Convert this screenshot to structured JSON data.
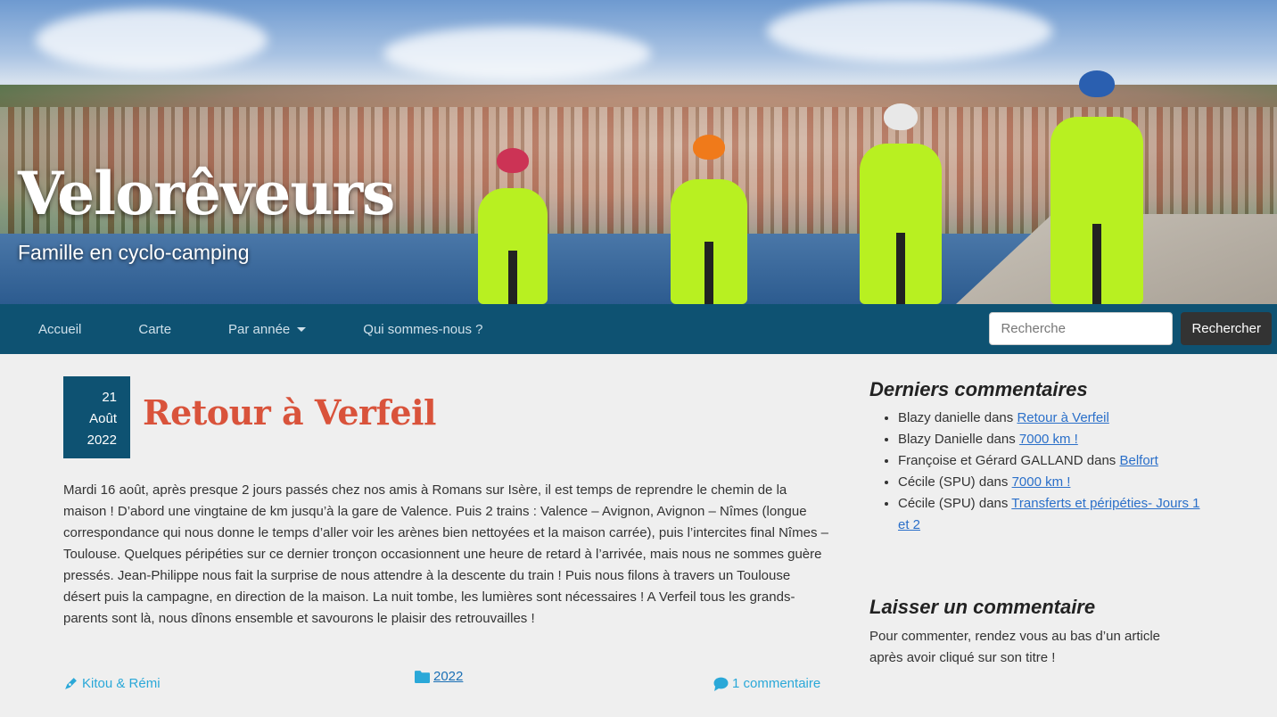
{
  "site": {
    "title": "Veloreveurs",
    "title_display": "Velorêveurs",
    "tagline": "Famille en cyclo-camping"
  },
  "nav": {
    "items": [
      {
        "label": "Accueil"
      },
      {
        "label": "Carte"
      },
      {
        "label": "Par année"
      },
      {
        "label": "Qui sommes-nous ?"
      }
    ],
    "search_placeholder": "Recherche",
    "search_button": "Rechercher"
  },
  "post": {
    "date": {
      "day": "21",
      "month": "Août",
      "year": "2022"
    },
    "title": "Retour à Verfeil",
    "body": "Mardi 16 août, après presque 2 jours passés chez nos amis à Romans sur Isère, il est temps de reprendre le chemin de la maison ! D’abord une vingtaine de km jusqu’à la gare de Valence. Puis 2 trains : Valence – Avignon, Avignon – Nîmes (longue correspondance qui nous donne le temps d’aller voir les arènes bien nettoyées et la maison carrée), puis l’intercites final Nîmes – Toulouse. Quelques péripéties sur ce dernier tronçon occasionnent une heure de retard à l’arrivée, mais nous ne sommes guère pressés. Jean-Philippe nous fait la surprise de nous attendre à la descente du train ! Puis nous filons à travers un Toulouse désert puis la campagne, en direction de la maison. La nuit tombe, les lumières sont nécessaires ! A Verfeil tous les grands-parents sont là, nous dînons ensemble et savourons le plaisir des retrouvailles !",
    "author": "Kitou & Rémi",
    "category": "2022",
    "comments": "1 commentaire"
  },
  "sidebar": {
    "recent_title": "Derniers commentaires",
    "recent": [
      {
        "author": "Blazy danielle",
        "sep": " dans ",
        "link": "Retour à Verfeil"
      },
      {
        "author": "Blazy Danielle",
        "sep": " dans ",
        "link": "7000 km !"
      },
      {
        "author": "Françoise et Gérard GALLAND",
        "sep": " dans ",
        "link": "Belfort"
      },
      {
        "author": "Cécile (SPU)",
        "sep": " dans ",
        "link": "7000 km !"
      },
      {
        "author": "Cécile (SPU)",
        "sep": " dans ",
        "link": "Transferts et péripéties- Jours 1 et 2"
      }
    ],
    "leave_title": "Laisser un commentaire",
    "leave_text": "Pour commenter, rendez vous au bas d’un article après avoir cliqué sur son titre  !"
  },
  "colors": {
    "nav_bg": "#0e5272",
    "title_accent": "#d9533b",
    "meta_accent": "#2aa8d8",
    "link": "#2a6fc9"
  }
}
